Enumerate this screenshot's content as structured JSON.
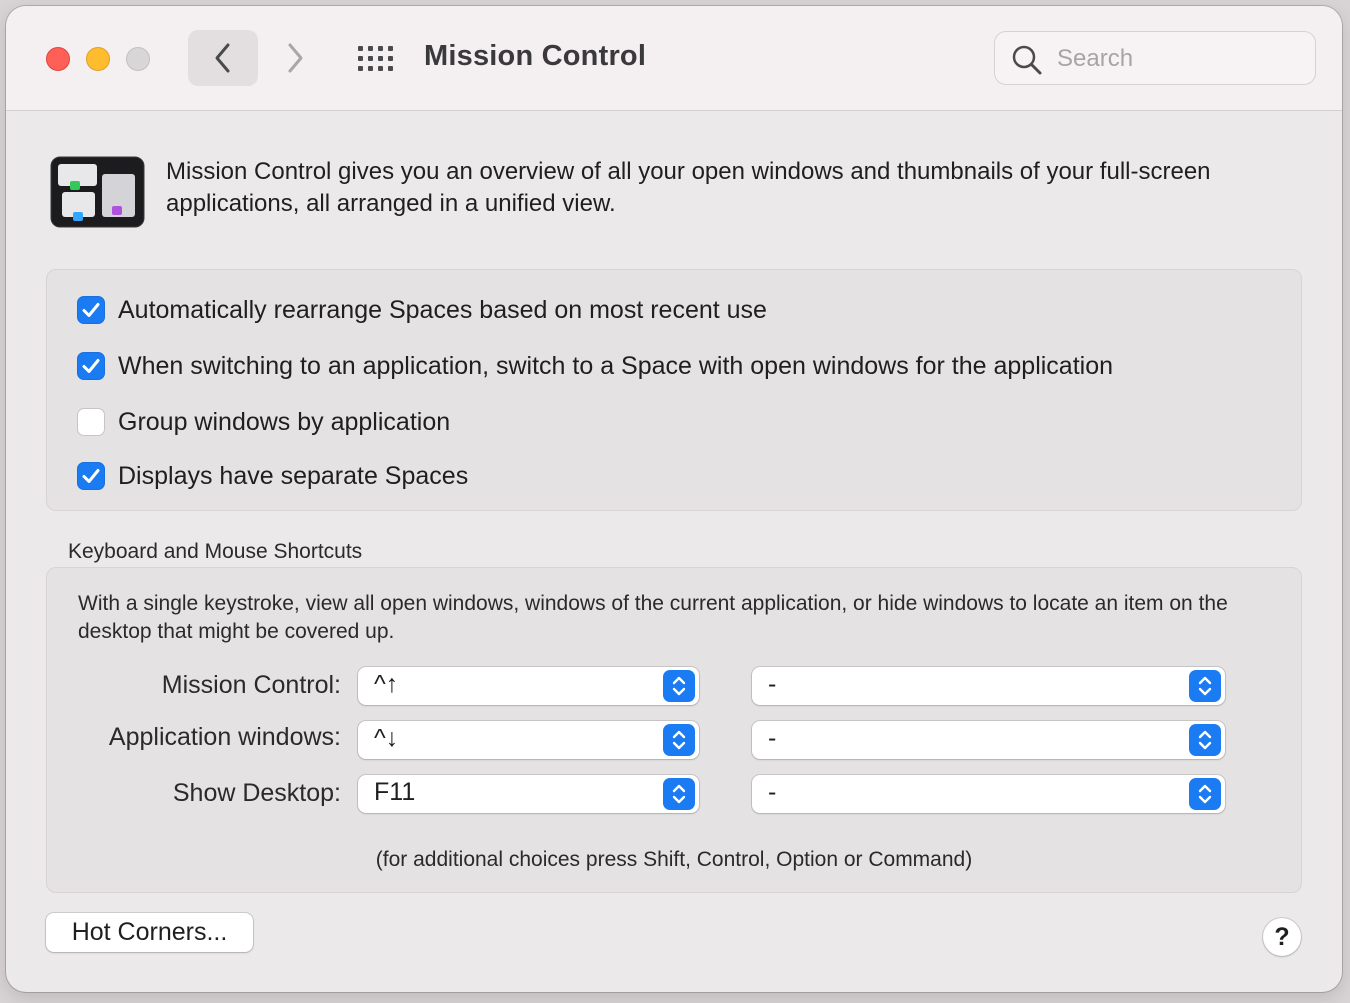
{
  "window": {
    "title": "Mission Control"
  },
  "toolbar": {
    "back_icon": "chevron-left-icon",
    "forward_icon": "chevron-right-icon",
    "grid_icon": "show-all-grid-icon",
    "search_placeholder": "Search",
    "search_value": ""
  },
  "header": {
    "icon": "mission-control-app-icon",
    "description": "Mission Control gives you an overview of all your open windows and thumbnails of your full-screen applications, all arranged in a unified view."
  },
  "options": [
    {
      "label": "Automatically rearrange Spaces based on most recent use",
      "checked": true
    },
    {
      "label": "When switching to an application, switch to a Space with open windows for the application",
      "checked": true
    },
    {
      "label": "Group windows by application",
      "checked": false
    },
    {
      "label": "Displays have separate Spaces",
      "checked": true
    }
  ],
  "shortcuts": {
    "title": "Keyboard and Mouse Shortcuts",
    "description": "With a single keystroke, view all open windows, windows of the current application, or hide windows to locate an item on the desktop that might be covered up.",
    "rows": [
      {
        "label": "Mission Control:",
        "keyboard": "^↑",
        "mouse": "-"
      },
      {
        "label": "Application windows:",
        "keyboard": "^↓",
        "mouse": "-"
      },
      {
        "label": "Show Desktop:",
        "keyboard": "F11",
        "mouse": "-"
      }
    ],
    "hint": "(for additional choices press Shift, Control, Option or Command)"
  },
  "footer": {
    "hot_corners_label": "Hot Corners...",
    "help_label": "?"
  },
  "colors": {
    "accent": "#1a7bf2",
    "close": "#fe5f57",
    "minimize": "#febc2e",
    "zoom_inactive": "#d9d6d7",
    "window_bg": "#ece9ea",
    "panel_bg": "#e5e2e3"
  }
}
